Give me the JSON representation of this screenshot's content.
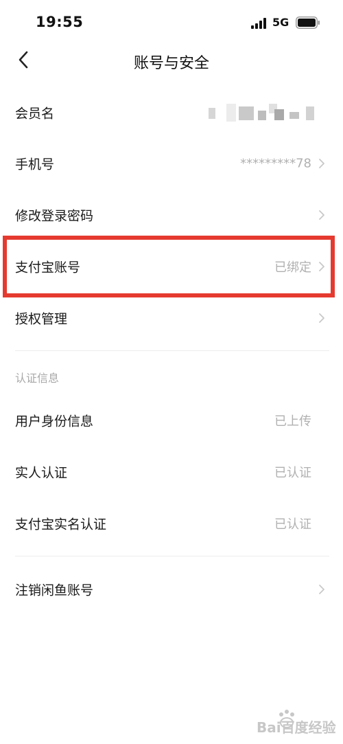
{
  "status_bar": {
    "time": "19:55",
    "network": "5G"
  },
  "nav": {
    "title": "账号与安全",
    "back_icon": "chevron-left-icon"
  },
  "rows": [
    {
      "label": "会员名",
      "value": "",
      "masked": true,
      "chevron": false
    },
    {
      "label": "手机号",
      "value": "*********78",
      "chevron": true
    },
    {
      "label": "修改登录密码",
      "value": "",
      "chevron": true
    },
    {
      "label": "支付宝账号",
      "value": "已绑定",
      "chevron": true,
      "highlighted": true
    },
    {
      "label": "授权管理",
      "value": "",
      "chevron": true
    }
  ],
  "section": {
    "header": "认证信息",
    "rows": [
      {
        "label": "用户身份信息",
        "value": "已上传",
        "chevron": false
      },
      {
        "label": "实人认证",
        "value": "已认证",
        "chevron": false
      },
      {
        "label": "支付宝实名认证",
        "value": "已认证",
        "chevron": false
      }
    ]
  },
  "footer_row": {
    "label": "注销闲鱼账号",
    "value": "",
    "chevron": true
  },
  "colors": {
    "highlight": "#e53a2f",
    "value_gray": "#b0b0b0",
    "divider": "#ececec"
  },
  "watermark": {
    "text": "Bai百度经验"
  }
}
